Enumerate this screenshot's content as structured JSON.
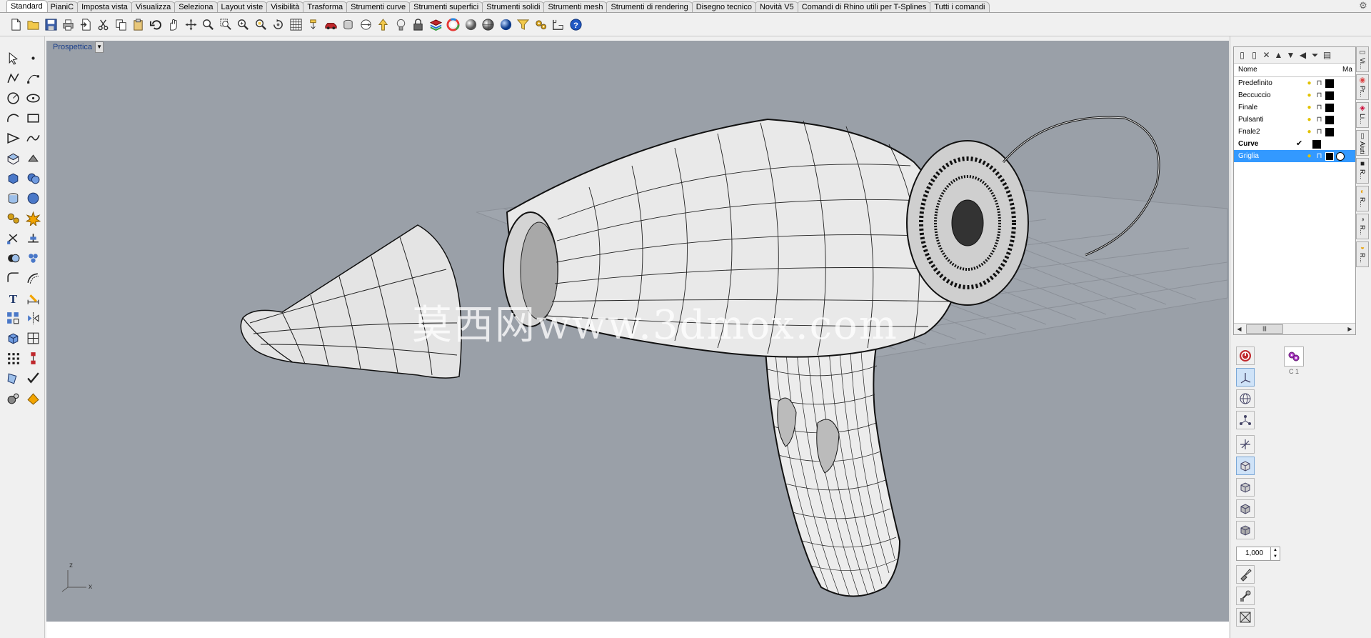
{
  "toolbar_tabs": [
    {
      "label": "Standard",
      "active": true
    },
    {
      "label": "PianiC",
      "active": false
    },
    {
      "label": "Imposta vista",
      "active": false
    },
    {
      "label": "Visualizza",
      "active": false
    },
    {
      "label": "Seleziona",
      "active": false
    },
    {
      "label": "Layout viste",
      "active": false
    },
    {
      "label": "Visibilità",
      "active": false
    },
    {
      "label": "Trasforma",
      "active": false
    },
    {
      "label": "Strumenti curve",
      "active": false
    },
    {
      "label": "Strumenti superfici",
      "active": false
    },
    {
      "label": "Strumenti solidi",
      "active": false
    },
    {
      "label": "Strumenti mesh",
      "active": false
    },
    {
      "label": "Strumenti di rendering",
      "active": false
    },
    {
      "label": "Disegno tecnico",
      "active": false
    },
    {
      "label": "Novità V5",
      "active": false
    },
    {
      "label": "Comandi di Rhino utili per T-Splines",
      "active": false
    },
    {
      "label": "Tutti i comandi",
      "active": false
    }
  ],
  "main_toolbar_icons": [
    "new-icon",
    "open-icon",
    "save-icon",
    "print-icon",
    "import-icon",
    "cut-icon",
    "copy-icon",
    "paste-icon",
    "undo-icon",
    "pan-icon",
    "rotate-view-icon",
    "zoom-icon",
    "zoom-window-icon",
    "zoom-extents-icon",
    "zoom-selected-icon",
    "rotate-icon",
    "four-viewports-icon",
    "select-all-icon",
    "car-icon",
    "cylinder-icon",
    "circle-dot-icon",
    "light-icon",
    "bulb-icon",
    "lock-icon",
    "layer-icon",
    "color-wheel-icon",
    "sphere-icon",
    "shaded-sphere-icon",
    "render-sphere-icon",
    "filter-icon",
    "options-icon",
    "grid-snap-icon",
    "help-icon"
  ],
  "left_tools": [
    "select-arrow-icon",
    "point-icon",
    "polyline-icon",
    "curve-points-icon",
    "circle-icon",
    "ellipse-icon",
    "arc-icon",
    "rectangle-icon",
    "polygon-icon",
    "free-curve-icon",
    "surface-points-icon",
    "extrude-icon",
    "box-icon",
    "solid-union-icon",
    "cylinder-tool-icon",
    "sphere-tool-icon",
    "gears-icon",
    "explode-icon",
    "trim-icon",
    "split-icon",
    "boolean-icon",
    "group-icon",
    "fillet-icon",
    "offset-icon",
    "text-icon",
    "dimension-icon",
    "array-icon",
    "mirror-icon",
    "mesh-box-icon",
    "cage-icon",
    "grid-array-icon",
    "transform-icon",
    "analyze-icon",
    "check-icon",
    "render-icon",
    "material-icon"
  ],
  "viewport": {
    "title": "Prospettica",
    "watermark": "莫西网www.3dmox.com",
    "axes": {
      "x": "x",
      "z": "z"
    }
  },
  "layers": {
    "toolbar_icons": [
      "new-layer-icon",
      "new-sublayer-icon",
      "delete-icon",
      "move-up-icon",
      "move-down-icon",
      "move-left-icon",
      "filter-icon",
      "properties-icon"
    ],
    "columns": {
      "name": "Nome",
      "material": "Ma"
    },
    "rows": [
      {
        "name": "Predefinito",
        "current": false,
        "selected": false,
        "color": "#000000"
      },
      {
        "name": "Beccuccio",
        "current": false,
        "selected": false,
        "color": "#000000"
      },
      {
        "name": "Finale",
        "current": false,
        "selected": false,
        "color": "#000000"
      },
      {
        "name": "Pulsanti",
        "current": false,
        "selected": false,
        "color": "#000000"
      },
      {
        "name": "Fnale2",
        "current": false,
        "selected": false,
        "color": "#000000"
      },
      {
        "name": "Curve",
        "current": true,
        "selected": false,
        "color": "#000000"
      },
      {
        "name": "Griglia",
        "current": false,
        "selected": true,
        "color": "#000000"
      }
    ],
    "scroll_thumb": "|||"
  },
  "side_tabs": [
    {
      "icon": "viewport-tab-icon",
      "label": "Vi..."
    },
    {
      "icon": "properties-tab-icon",
      "label": "Pr..."
    },
    {
      "icon": "layers-tab-icon",
      "label": "Li..."
    },
    {
      "icon": "help-tab-icon",
      "label": "Aiuti"
    },
    {
      "icon": "rg-tab-icon",
      "label": "R..."
    },
    {
      "icon": "render-tab-icon",
      "label": "R..."
    },
    {
      "icon": "render2-tab-icon",
      "label": "R..."
    },
    {
      "icon": "render3-tab-icon",
      "label": "R..."
    }
  ],
  "gumball": {
    "c1_label": "C 1",
    "scale_value": "1,000"
  },
  "colors": {
    "viewport_bg": "#9aa0a8",
    "selection": "#3399ff",
    "accent_red": "#c0282d"
  }
}
